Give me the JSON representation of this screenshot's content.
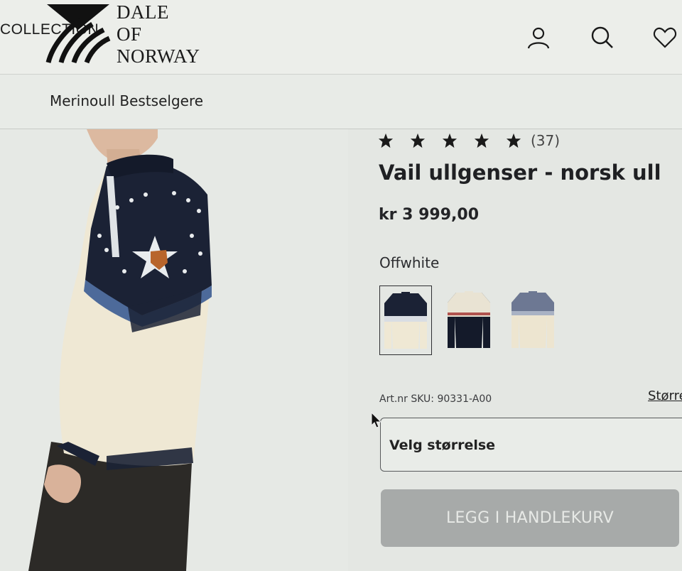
{
  "header": {
    "collection_label": "COLLECTION",
    "brand_line1": "DALE",
    "brand_line2": "OF",
    "brand_line3": "NORWAY",
    "icons": [
      "user-icon",
      "search-icon",
      "heart-icon"
    ]
  },
  "nav": {
    "label": "Merinoull Bestselgere"
  },
  "product": {
    "rating": 5,
    "rating_count": "(37)",
    "title": "Vail ullgenser - norsk ull",
    "price": "kr 3 999,00",
    "color_label": "Offwhite",
    "swatches": [
      "offwhite",
      "navy",
      "beige"
    ],
    "selected_swatch": 0,
    "sku": "Art.nr SKU: 90331-A00",
    "size_guide": "Størrelse",
    "size_select": "Velg størrelse",
    "add_to_cart": "LEGG I HANDLEKURV"
  },
  "colors": {
    "background": "#e4e7e3",
    "navy": "#1b2235",
    "cream": "#efe8d4",
    "button_disabled": "#a7aaa9"
  }
}
